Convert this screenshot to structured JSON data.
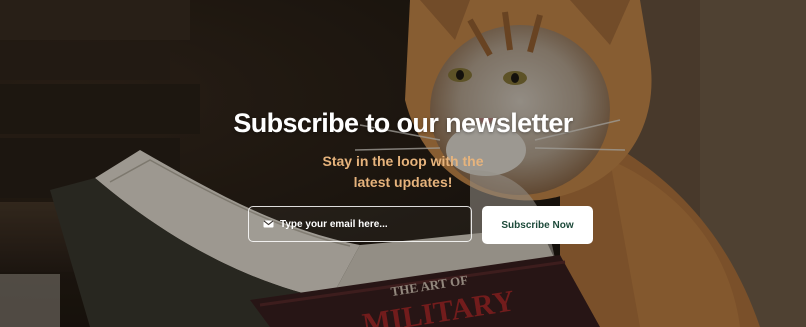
{
  "hero": {
    "background_image": "orange-and-white-cat-reading-book",
    "book_cover_text": [
      "THE ART OF",
      "MILITARY"
    ]
  },
  "newsletter": {
    "title": "Subscribe to our newsletter",
    "subtitle": "Stay in the loop with the latest updates!",
    "email_placeholder": "Type your email here...",
    "email_value": "",
    "email_icon": "mail-icon",
    "button_label": "Subscribe Now"
  },
  "colors": {
    "title": "#ffffff",
    "subtitle": "#e6b37c",
    "button_bg": "#ffffff",
    "button_text": "#1d4a3a",
    "input_border": "#ffffff"
  }
}
